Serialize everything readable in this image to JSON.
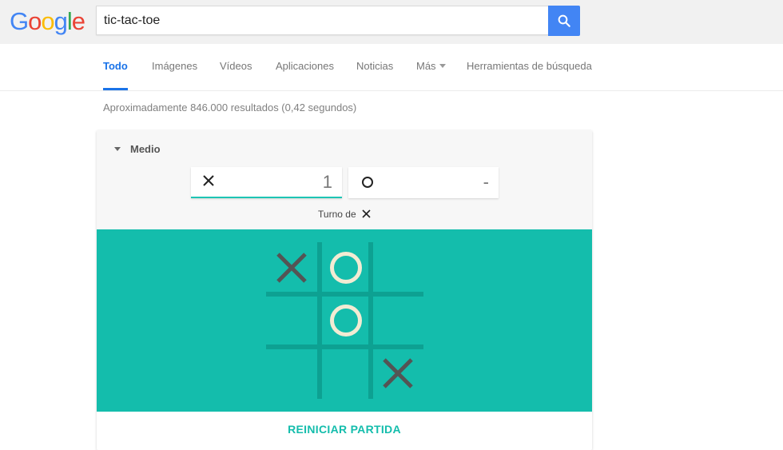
{
  "logo": {
    "text": "Google"
  },
  "search": {
    "query": "tic-tac-toe"
  },
  "tabs": [
    {
      "label": "Todo",
      "active": true
    },
    {
      "label": "Imágenes"
    },
    {
      "label": "Vídeos"
    },
    {
      "label": "Aplicaciones"
    },
    {
      "label": "Noticias"
    },
    {
      "label": "Más"
    },
    {
      "label": "Herramientas de búsqueda"
    }
  ],
  "result_stats": "Aproximadamente 846.000 resultados (0,42 segundos)",
  "game": {
    "difficulty": "Medio",
    "score_x": "1",
    "score_o": "-",
    "turn_label": "Turno de",
    "turn_symbol": "x-mark",
    "board": [
      "X",
      "O",
      "",
      "",
      "O",
      "",
      "",
      "",
      "X"
    ],
    "restart_label": "REINICIAR PARTIDA",
    "colors": {
      "board_bg": "#14bdac",
      "grid_line": "#0da192",
      "x_mark": "#545454",
      "o_mark": "#f2ebd3",
      "accent": "#14bdac"
    }
  }
}
